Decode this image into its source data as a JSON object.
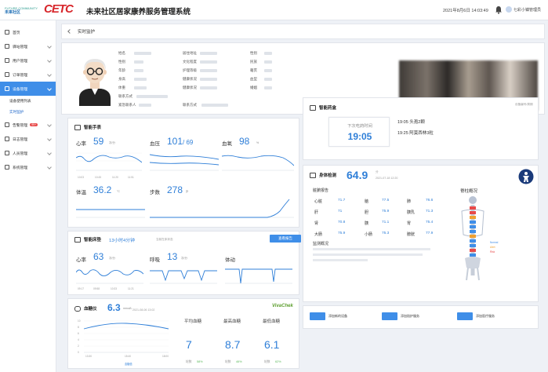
{
  "header": {
    "logo_line1": "FUTURE COMMUNITY",
    "logo_line2": "未来社区",
    "logo_brand": "CETC",
    "title": "未来社区居家康养服务管理系统",
    "datetime": "2021年8月6日 14:03:49",
    "username": "七彩小镇管理员"
  },
  "sidebar": {
    "items": [
      {
        "label": "首页"
      },
      {
        "label": "驿站管理"
      },
      {
        "label": "用户管理"
      },
      {
        "label": "订单管理"
      },
      {
        "label": "设备管理"
      },
      {
        "label": "告警管理",
        "badge": "99+"
      },
      {
        "label": "日志管理"
      },
      {
        "label": "人员管理"
      },
      {
        "label": "系统管理"
      }
    ],
    "sub_items": [
      {
        "label": "设备使用列表"
      },
      {
        "label": "实时监护"
      }
    ]
  },
  "breadcrumb": {
    "title": "实时监护"
  },
  "profile": {
    "labels": {
      "name": "姓名",
      "gender": "性别",
      "age": "年龄",
      "height": "身高",
      "weight": "体重",
      "contact": "联系方式",
      "family": "紧急联系人",
      "household": "居住地址",
      "culture": "文化程度",
      "nursing": "护理等级",
      "health": "健康状况",
      "contact2": "联系方式",
      "c3a": "性别",
      "c3b": "民族",
      "c3c": "籍贯",
      "c3d": "血型",
      "c3e": "婚姻"
    }
  },
  "watch": {
    "title": "智能手表",
    "hr_label": "心率",
    "hr_value": "59",
    "hr_unit": "次/分",
    "bp_label": "血压",
    "bp_value": "101",
    "bp_value2": "/ 69",
    "spo2_label": "血氧",
    "spo2_value": "98",
    "spo2_unit": "%",
    "temp_label": "体温",
    "temp_value": "36.2",
    "temp_unit": "°C",
    "steps_label": "步数",
    "steps_value": "278",
    "steps_unit": "步",
    "times": [
      "10:03",
      "10:45",
      "11:20",
      "11:51"
    ]
  },
  "mattress": {
    "title": "智能床垫",
    "sleep_time": "13小时4分钟",
    "small_note": "当前在床状态",
    "report_btn": "查看报告",
    "hr_label": "心率",
    "hr_value": "63",
    "hr_unit": "次/分",
    "resp_label": "呼吸",
    "resp_value": "13",
    "resp_unit": "次/分",
    "move_label": "体动",
    "times": [
      "09:17",
      "09:58",
      "10:33",
      "11:21"
    ]
  },
  "glucose": {
    "title": "血糖仪",
    "value": "6.3",
    "unit": "mmol/L",
    "time": "2021-08-06 13:02",
    "brand": "VivaChek",
    "avg_label": "平均血糖",
    "avg_value": "7",
    "max_label": "最高血糖",
    "max_value": "8.7",
    "min_label": "最低血糖",
    "min_value": "6.1",
    "ratio_label": "轮数",
    "avg_pct": "58%",
    "max_pct": "46%",
    "min_pct": "62%",
    "y_ticks": [
      "10",
      "8",
      "6",
      "4",
      "2",
      "0"
    ],
    "x_ticks": [
      "13:30",
      "15:40",
      "18:00"
    ],
    "legend": "血糖值"
  },
  "medicine": {
    "title": "智能药盒",
    "small_note": "设备编号/周期",
    "next_label": "下次吃药时间",
    "next_time": "19:05",
    "row1": "19:05 头孢2颗",
    "row2": "19:25 阿莫西林3粒"
  },
  "body": {
    "title": "身体检测",
    "score": "64.9",
    "score_unit": "分",
    "score_time": "2021-07-18 12:20",
    "organ_title": "脏腑报告",
    "spine_title": "脊柱概况",
    "organs": [
      {
        "n1": "心脏",
        "v1": "71.7",
        "n2": "脑",
        "v2": "77.5",
        "n3": "肺",
        "v3": "76.6"
      },
      {
        "n1": "肝",
        "v1": "71",
        "n2": "胆",
        "v2": "75.9",
        "n3": "胰乳",
        "v3": "71.3"
      },
      {
        "n1": "肾",
        "v1": "70.8",
        "n2": "胰",
        "v2": "71.1",
        "n3": "胃",
        "v3": "75.4"
      },
      {
        "n1": "大肠",
        "v1": "75.9",
        "n2": "小肠",
        "v2": "75.3",
        "n3": "膀胱",
        "v3": "77.9"
      }
    ],
    "monitor_title": "监测概况",
    "legend": [
      "Normal",
      "Alert",
      "Risk"
    ]
  },
  "actions": {
    "add_device": "添加新的设备",
    "add_nursing": "添加陪护服务",
    "add_medical": "添加医疗服务"
  }
}
